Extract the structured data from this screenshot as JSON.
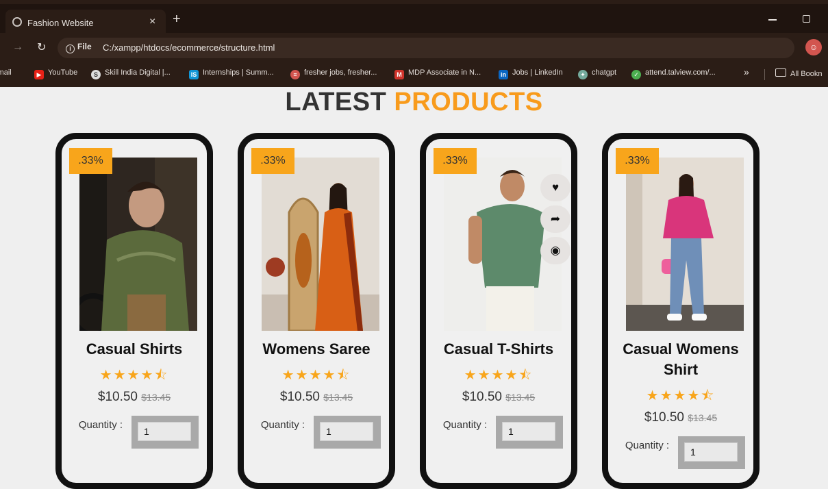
{
  "browser": {
    "tab_title": "Fashion Website",
    "tab_close": "×",
    "new_tab": "+",
    "url_chip": "File",
    "url": "C:/xampp/htdocs/ecommerce/structure.html",
    "bookmarks": [
      {
        "label": "Gmail",
        "icon": "gmail-icon",
        "color": "#ffffff"
      },
      {
        "label": "YouTube",
        "icon": "youtube-icon",
        "color": "#e62117"
      },
      {
        "label": "Skill India Digital |...",
        "icon": "skill-india-icon",
        "color": "#dddddd"
      },
      {
        "label": "Internships | Summ...",
        "icon": "internshala-icon",
        "color": "#1196d6"
      },
      {
        "label": "fresher jobs, fresher...",
        "icon": "naukri-icon",
        "color": "#d2554f"
      },
      {
        "label": "MDP Associate in N...",
        "icon": "mdp-icon",
        "color": "#d0342c"
      },
      {
        "label": "Jobs | LinkedIn",
        "icon": "linkedin-icon",
        "color": "#0a66c2"
      },
      {
        "label": "chatgpt",
        "icon": "chatgpt-icon",
        "color": "#74aa9c"
      },
      {
        "label": "attend.talview.com/...",
        "icon": "talview-icon",
        "color": "#4caf50"
      }
    ],
    "more_bookmarks": "»",
    "all_bookmarks": "All Bookn"
  },
  "page": {
    "heading_part1": "LATEST",
    "heading_part2": "PRODUCTS",
    "accent_color": "#f89b1c",
    "quantity_label": "Quantity :",
    "products": [
      {
        "name": "Casual Shirts",
        "badge": ".33%",
        "stars": "★★★★⯪",
        "rating": 4.5,
        "price": "$10.50",
        "old_price": "$13.45",
        "quantity": "1"
      },
      {
        "name": "Womens Saree",
        "badge": ".33%",
        "stars": "★★★★⯪",
        "rating": 4.5,
        "price": "$10.50",
        "old_price": "$13.45",
        "quantity": "1"
      },
      {
        "name": "Casual T-Shirts",
        "badge": ".33%",
        "stars": "★★★★⯪",
        "rating": 4.5,
        "price": "$10.50",
        "old_price": "$13.45",
        "quantity": "1",
        "actions": [
          "heart-icon",
          "share-icon",
          "eye-icon"
        ]
      },
      {
        "name": "Casual Womens Shirt",
        "badge": ".33%",
        "stars": "★★★★⯪",
        "rating": 4.5,
        "price": "$10.50",
        "old_price": "$13.45",
        "quantity": "1"
      }
    ]
  }
}
